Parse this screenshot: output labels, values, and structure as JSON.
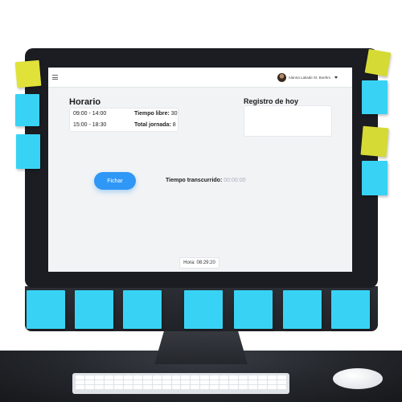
{
  "topbar": {
    "user_name": "Alanna Lakade St. Boehm"
  },
  "horario": {
    "title": "Horario",
    "slot_1": "09:00 - 14:00",
    "slot_2": "15:00 - 18:30",
    "tiempo_libre_label": "Tiempo libre:",
    "tiempo_libre_value": "30",
    "total_jornada_label": "Total jornada:",
    "total_jornada_value": "8"
  },
  "registro": {
    "title": "Registro de hoy"
  },
  "fichar": {
    "button_label": "Fichar",
    "elapsed_label": "Tiempo transcurrido:",
    "elapsed_value": "00:00:00"
  },
  "footer": {
    "hora": "Hora: 08:29:20"
  },
  "colors": {
    "accent": "#2f97f5",
    "note_cyan": "#36d2f3",
    "note_yellow": "#d9dc3a",
    "screen_bg": "#f1f3f5"
  }
}
